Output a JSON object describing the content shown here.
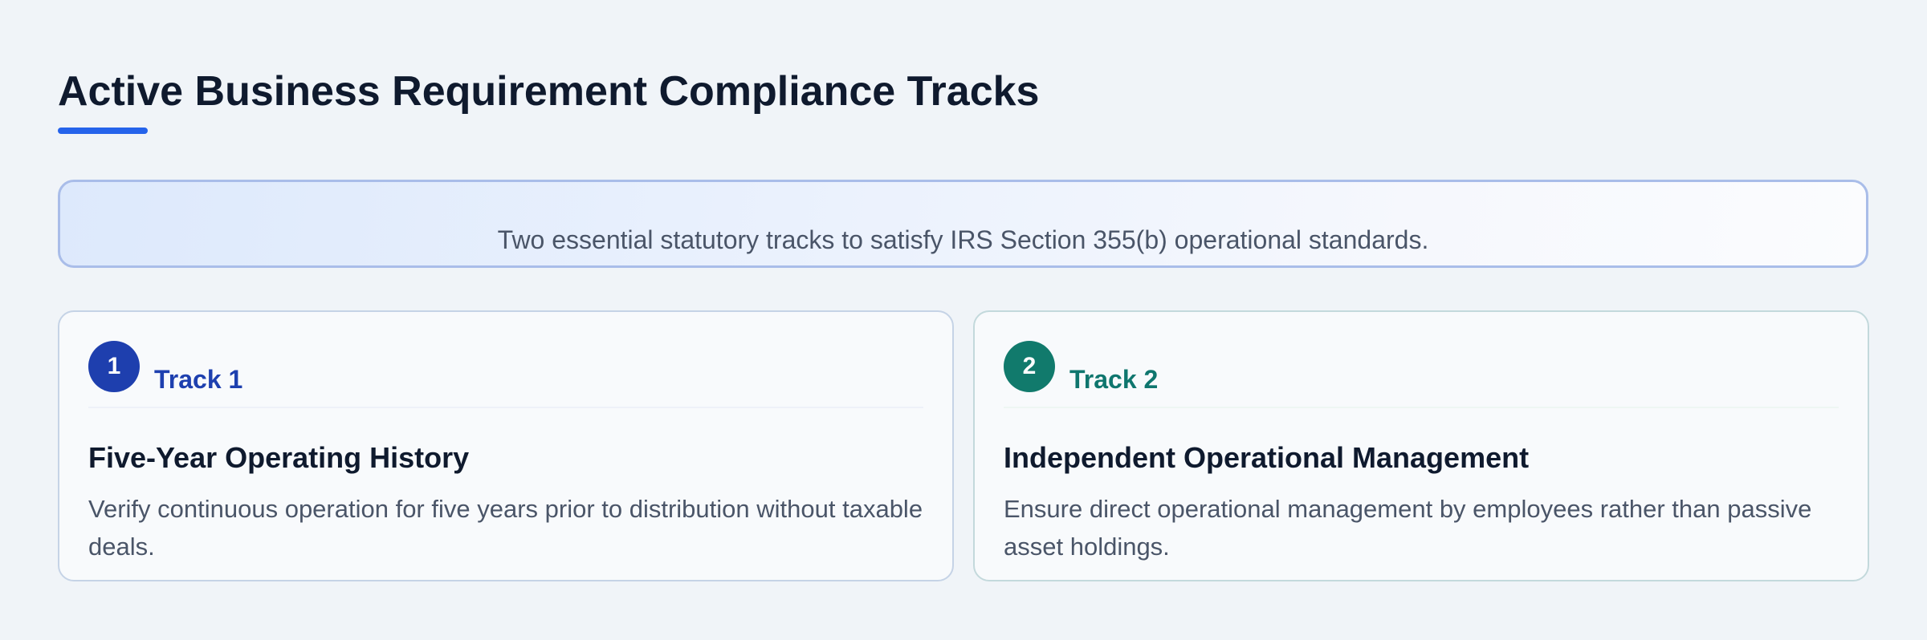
{
  "page": {
    "title": "Active Business Requirement Compliance Tracks",
    "accent_color": "#2563eb",
    "background_color": "#f0f4f8"
  },
  "banner": {
    "text": "Two essential statutory tracks to satisfy IRS Section 355(b) operational standards."
  },
  "tracks": [
    {
      "number": "1",
      "label": "Track 1",
      "heading": "Five-Year Operating History",
      "description": "Verify continuous operation for five years prior to distribution without taxable deals.",
      "color": "#1e40af"
    },
    {
      "number": "2",
      "label": "Track 2",
      "heading": "Independent Operational Management",
      "description": "Ensure direct operational management by employees rather than passive asset holdings.",
      "color": "#0f766e"
    }
  ]
}
